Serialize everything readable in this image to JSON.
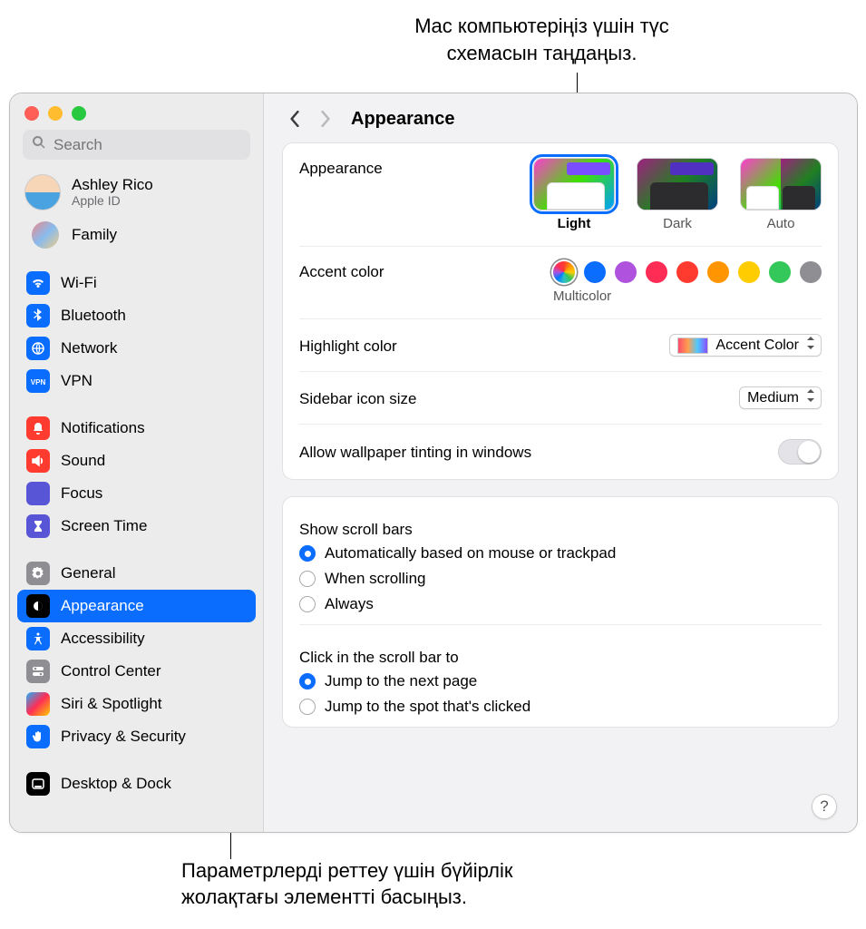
{
  "callouts": {
    "top": "Mac компьютеріңіз үшін түс\nсхемасын таңдаңыз.",
    "bottom": "Параметрлерді реттеу үшін бүйірлік\nжолақтағы элементті басыңыз."
  },
  "search": {
    "placeholder": "Search"
  },
  "user": {
    "name": "Ashley Rico",
    "sub": "Apple ID"
  },
  "family": {
    "label": "Family"
  },
  "sidebar": {
    "group1": [
      {
        "label": "Wi-Fi",
        "icon": "wifi",
        "bg": "#0a6dfd"
      },
      {
        "label": "Bluetooth",
        "icon": "bluetooth",
        "bg": "#0a6dfd"
      },
      {
        "label": "Network",
        "icon": "globe",
        "bg": "#0a6dfd"
      },
      {
        "label": "VPN",
        "icon": "vpn",
        "bg": "#0a6dfd"
      }
    ],
    "group2": [
      {
        "label": "Notifications",
        "icon": "bell",
        "bg": "#ff3b30"
      },
      {
        "label": "Sound",
        "icon": "speaker",
        "bg": "#ff3b30"
      },
      {
        "label": "Focus",
        "icon": "moon",
        "bg": "#5856d6"
      },
      {
        "label": "Screen Time",
        "icon": "hourglass",
        "bg": "#5856d6"
      }
    ],
    "group3": [
      {
        "label": "General",
        "icon": "gear",
        "bg": "#8e8e93"
      },
      {
        "label": "Appearance",
        "icon": "appearance",
        "bg": "#000",
        "selected": true
      },
      {
        "label": "Accessibility",
        "icon": "accessibility",
        "bg": "#0a6dfd"
      },
      {
        "label": "Control Center",
        "icon": "switches",
        "bg": "#8e8e93"
      },
      {
        "label": "Siri & Spotlight",
        "icon": "siri",
        "bg": "linear-gradient(135deg,#1fb1ff,#ff2d55,#ffcc00)"
      },
      {
        "label": "Privacy & Security",
        "icon": "hand",
        "bg": "#0a6dfd"
      }
    ],
    "group4": [
      {
        "label": "Desktop & Dock",
        "icon": "dock",
        "bg": "#000"
      }
    ]
  },
  "header": {
    "title": "Appearance"
  },
  "appearance": {
    "label": "Appearance",
    "options": [
      "Light",
      "Dark",
      "Auto"
    ],
    "selected": "Light"
  },
  "accent": {
    "label": "Accent color",
    "selected_label": "Multicolor",
    "colors": [
      "conic-gradient(#ff3b30,#ff9500,#ffcc00,#34c759,#30c0c6,#007aff,#af52de,#ff2d55,#ff3b30)",
      "#0a6dfd",
      "#af52de",
      "#ff2d55",
      "#ff3b30",
      "#ff9500",
      "#ffcc00",
      "#34c759",
      "#8e8e93"
    ]
  },
  "highlight": {
    "label": "Highlight color",
    "value": "Accent Color"
  },
  "sidebar_size": {
    "label": "Sidebar icon size",
    "value": "Medium"
  },
  "tinting": {
    "label": "Allow wallpaper tinting in windows",
    "on": false
  },
  "scroll_show": {
    "label": "Show scroll bars",
    "options": [
      "Automatically based on mouse or trackpad",
      "When scrolling",
      "Always"
    ],
    "selected": 0
  },
  "scroll_click": {
    "label": "Click in the scroll bar to",
    "options": [
      "Jump to the next page",
      "Jump to the spot that's clicked"
    ],
    "selected": 0
  },
  "help": "?"
}
